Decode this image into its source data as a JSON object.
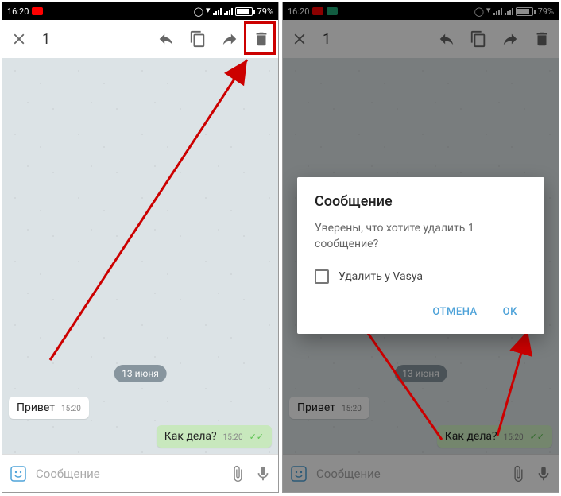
{
  "status": {
    "time": "16:20",
    "battery": "79%"
  },
  "appbar": {
    "count": "1"
  },
  "chat": {
    "date": "13 июня",
    "msgIn": {
      "text": "Привет",
      "time": "15:20"
    },
    "msgOut": {
      "text": "Как дела?",
      "time": "15:20"
    }
  },
  "input": {
    "placeholder": "Сообщение"
  },
  "dialog": {
    "title": "Сообщение",
    "body": "Уверены, что хотите удалить 1 сообщение?",
    "check": "Удалить у Vasya",
    "cancel": "ОТМЕНА",
    "ok": "ОК"
  }
}
